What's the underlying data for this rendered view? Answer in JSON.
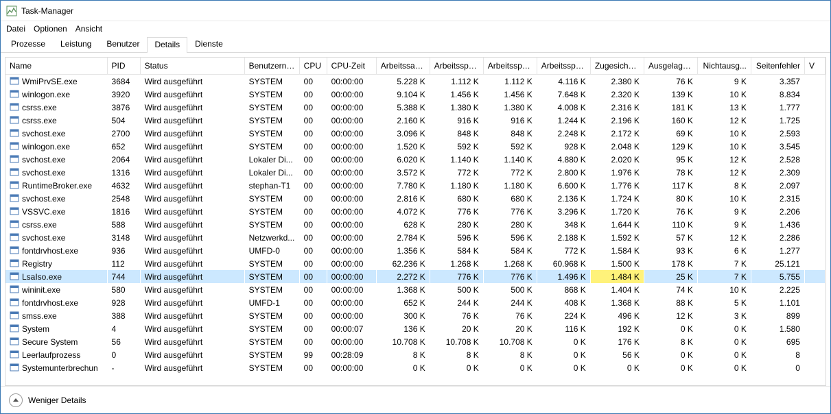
{
  "window_title": "Task-Manager",
  "menu": {
    "file": "Datei",
    "options": "Optionen",
    "view": "Ansicht"
  },
  "tabs": {
    "processes": "Prozesse",
    "performance": "Leistung",
    "users": "Benutzer",
    "details": "Details",
    "services": "Dienste"
  },
  "columns": {
    "name": "Name",
    "pid": "PID",
    "status": "Status",
    "user": "Benutzerna...",
    "cpu": "CPU",
    "cputime": "CPU-Zeit",
    "ws": "Arbeitssatz...",
    "mem1": "Arbeitsspei...",
    "mem2": "Arbeitsspei...",
    "mem3": "Arbeitsspei...",
    "commit": "Zugesicher...",
    "paged": "Ausgelager...",
    "nonpaged": "Nichtausg...",
    "faults": "Seitenfehler",
    "v": "V"
  },
  "footer": {
    "fewer": "Weniger Details"
  },
  "rows": [
    {
      "name": "WmiPrvSE.exe",
      "pid": "3684",
      "status": "Wird ausgeführt",
      "user": "SYSTEM",
      "cpu": "00",
      "cput": "00:00:00",
      "ws": "5.228 K",
      "m1": "1.112 K",
      "m2": "1.112 K",
      "m3": "4.116 K",
      "cm": "2.380 K",
      "pg": "76 K",
      "np": "9 K",
      "pf": "3.357"
    },
    {
      "name": "winlogon.exe",
      "pid": "3920",
      "status": "Wird ausgeführt",
      "user": "SYSTEM",
      "cpu": "00",
      "cput": "00:00:00",
      "ws": "9.104 K",
      "m1": "1.456 K",
      "m2": "1.456 K",
      "m3": "7.648 K",
      "cm": "2.320 K",
      "pg": "139 K",
      "np": "10 K",
      "pf": "8.834"
    },
    {
      "name": "csrss.exe",
      "pid": "3876",
      "status": "Wird ausgeführt",
      "user": "SYSTEM",
      "cpu": "00",
      "cput": "00:00:00",
      "ws": "5.388 K",
      "m1": "1.380 K",
      "m2": "1.380 K",
      "m3": "4.008 K",
      "cm": "2.316 K",
      "pg": "181 K",
      "np": "13 K",
      "pf": "1.777"
    },
    {
      "name": "csrss.exe",
      "pid": "504",
      "status": "Wird ausgeführt",
      "user": "SYSTEM",
      "cpu": "00",
      "cput": "00:00:00",
      "ws": "2.160 K",
      "m1": "916 K",
      "m2": "916 K",
      "m3": "1.244 K",
      "cm": "2.196 K",
      "pg": "160 K",
      "np": "12 K",
      "pf": "1.725"
    },
    {
      "name": "svchost.exe",
      "pid": "2700",
      "status": "Wird ausgeführt",
      "user": "SYSTEM",
      "cpu": "00",
      "cput": "00:00:00",
      "ws": "3.096 K",
      "m1": "848 K",
      "m2": "848 K",
      "m3": "2.248 K",
      "cm": "2.172 K",
      "pg": "69 K",
      "np": "10 K",
      "pf": "2.593"
    },
    {
      "name": "winlogon.exe",
      "pid": "652",
      "status": "Wird ausgeführt",
      "user": "SYSTEM",
      "cpu": "00",
      "cput": "00:00:00",
      "ws": "1.520 K",
      "m1": "592 K",
      "m2": "592 K",
      "m3": "928 K",
      "cm": "2.048 K",
      "pg": "129 K",
      "np": "10 K",
      "pf": "3.545"
    },
    {
      "name": "svchost.exe",
      "pid": "2064",
      "status": "Wird ausgeführt",
      "user": "Lokaler Di...",
      "cpu": "00",
      "cput": "00:00:00",
      "ws": "6.020 K",
      "m1": "1.140 K",
      "m2": "1.140 K",
      "m3": "4.880 K",
      "cm": "2.020 K",
      "pg": "95 K",
      "np": "12 K",
      "pf": "2.528"
    },
    {
      "name": "svchost.exe",
      "pid": "1316",
      "status": "Wird ausgeführt",
      "user": "Lokaler Di...",
      "cpu": "00",
      "cput": "00:00:00",
      "ws": "3.572 K",
      "m1": "772 K",
      "m2": "772 K",
      "m3": "2.800 K",
      "cm": "1.976 K",
      "pg": "78 K",
      "np": "12 K",
      "pf": "2.309"
    },
    {
      "name": "RuntimeBroker.exe",
      "pid": "4632",
      "status": "Wird ausgeführt",
      "user": "stephan-T1",
      "cpu": "00",
      "cput": "00:00:00",
      "ws": "7.780 K",
      "m1": "1.180 K",
      "m2": "1.180 K",
      "m3": "6.600 K",
      "cm": "1.776 K",
      "pg": "117 K",
      "np": "8 K",
      "pf": "2.097"
    },
    {
      "name": "svchost.exe",
      "pid": "2548",
      "status": "Wird ausgeführt",
      "user": "SYSTEM",
      "cpu": "00",
      "cput": "00:00:00",
      "ws": "2.816 K",
      "m1": "680 K",
      "m2": "680 K",
      "m3": "2.136 K",
      "cm": "1.724 K",
      "pg": "80 K",
      "np": "10 K",
      "pf": "2.315"
    },
    {
      "name": "VSSVC.exe",
      "pid": "1816",
      "status": "Wird ausgeführt",
      "user": "SYSTEM",
      "cpu": "00",
      "cput": "00:00:00",
      "ws": "4.072 K",
      "m1": "776 K",
      "m2": "776 K",
      "m3": "3.296 K",
      "cm": "1.720 K",
      "pg": "76 K",
      "np": "9 K",
      "pf": "2.206"
    },
    {
      "name": "csrss.exe",
      "pid": "588",
      "status": "Wird ausgeführt",
      "user": "SYSTEM",
      "cpu": "00",
      "cput": "00:00:00",
      "ws": "628 K",
      "m1": "280 K",
      "m2": "280 K",
      "m3": "348 K",
      "cm": "1.644 K",
      "pg": "110 K",
      "np": "9 K",
      "pf": "1.436"
    },
    {
      "name": "svchost.exe",
      "pid": "3148",
      "status": "Wird ausgeführt",
      "user": "Netzwerkd...",
      "cpu": "00",
      "cput": "00:00:00",
      "ws": "2.784 K",
      "m1": "596 K",
      "m2": "596 K",
      "m3": "2.188 K",
      "cm": "1.592 K",
      "pg": "57 K",
      "np": "12 K",
      "pf": "2.286"
    },
    {
      "name": "fontdrvhost.exe",
      "pid": "936",
      "status": "Wird ausgeführt",
      "user": "UMFD-0",
      "cpu": "00",
      "cput": "00:00:00",
      "ws": "1.356 K",
      "m1": "584 K",
      "m2": "584 K",
      "m3": "772 K",
      "cm": "1.584 K",
      "pg": "93 K",
      "np": "6 K",
      "pf": "1.277"
    },
    {
      "name": "Registry",
      "pid": "112",
      "status": "Wird ausgeführt",
      "user": "SYSTEM",
      "cpu": "00",
      "cput": "00:00:00",
      "ws": "62.236 K",
      "m1": "1.268 K",
      "m2": "1.268 K",
      "m3": "60.968 K",
      "cm": "1.500 K",
      "pg": "178 K",
      "np": "7 K",
      "pf": "25.121"
    },
    {
      "name": "LsaIso.exe",
      "pid": "744",
      "status": "Wird ausgeführt",
      "user": "SYSTEM",
      "cpu": "00",
      "cput": "00:00:00",
      "ws": "2.272 K",
      "m1": "776 K",
      "m2": "776 K",
      "m3": "1.496 K",
      "cm": "1.484 K",
      "pg": "25 K",
      "np": "7 K",
      "pf": "5.755",
      "selected": true,
      "highlight_col": "cm"
    },
    {
      "name": "wininit.exe",
      "pid": "580",
      "status": "Wird ausgeführt",
      "user": "SYSTEM",
      "cpu": "00",
      "cput": "00:00:00",
      "ws": "1.368 K",
      "m1": "500 K",
      "m2": "500 K",
      "m3": "868 K",
      "cm": "1.404 K",
      "pg": "74 K",
      "np": "10 K",
      "pf": "2.225"
    },
    {
      "name": "fontdrvhost.exe",
      "pid": "928",
      "status": "Wird ausgeführt",
      "user": "UMFD-1",
      "cpu": "00",
      "cput": "00:00:00",
      "ws": "652 K",
      "m1": "244 K",
      "m2": "244 K",
      "m3": "408 K",
      "cm": "1.368 K",
      "pg": "88 K",
      "np": "5 K",
      "pf": "1.101"
    },
    {
      "name": "smss.exe",
      "pid": "388",
      "status": "Wird ausgeführt",
      "user": "SYSTEM",
      "cpu": "00",
      "cput": "00:00:00",
      "ws": "300 K",
      "m1": "76 K",
      "m2": "76 K",
      "m3": "224 K",
      "cm": "496 K",
      "pg": "12 K",
      "np": "3 K",
      "pf": "899"
    },
    {
      "name": "System",
      "pid": "4",
      "status": "Wird ausgeführt",
      "user": "SYSTEM",
      "cpu": "00",
      "cput": "00:00:07",
      "ws": "136 K",
      "m1": "20 K",
      "m2": "20 K",
      "m3": "116 K",
      "cm": "192 K",
      "pg": "0 K",
      "np": "0 K",
      "pf": "1.580"
    },
    {
      "name": "Secure System",
      "pid": "56",
      "status": "Wird ausgeführt",
      "user": "SYSTEM",
      "cpu": "00",
      "cput": "00:00:00",
      "ws": "10.708 K",
      "m1": "10.708 K",
      "m2": "10.708 K",
      "m3": "0 K",
      "cm": "176 K",
      "pg": "8 K",
      "np": "0 K",
      "pf": "695"
    },
    {
      "name": "Leerlaufprozess",
      "pid": "0",
      "status": "Wird ausgeführt",
      "user": "SYSTEM",
      "cpu": "99",
      "cput": "00:28:09",
      "ws": "8 K",
      "m1": "8 K",
      "m2": "8 K",
      "m3": "0 K",
      "cm": "56 K",
      "pg": "0 K",
      "np": "0 K",
      "pf": "8"
    },
    {
      "name": "Systemunterbrechun",
      "pid": "-",
      "status": "Wird ausgeführt",
      "user": "SYSTEM",
      "cpu": "00",
      "cput": "00:00:00",
      "ws": "0 K",
      "m1": "0 K",
      "m2": "0 K",
      "m3": "0 K",
      "cm": "0 K",
      "pg": "0 K",
      "np": "0 K",
      "pf": "0"
    }
  ]
}
